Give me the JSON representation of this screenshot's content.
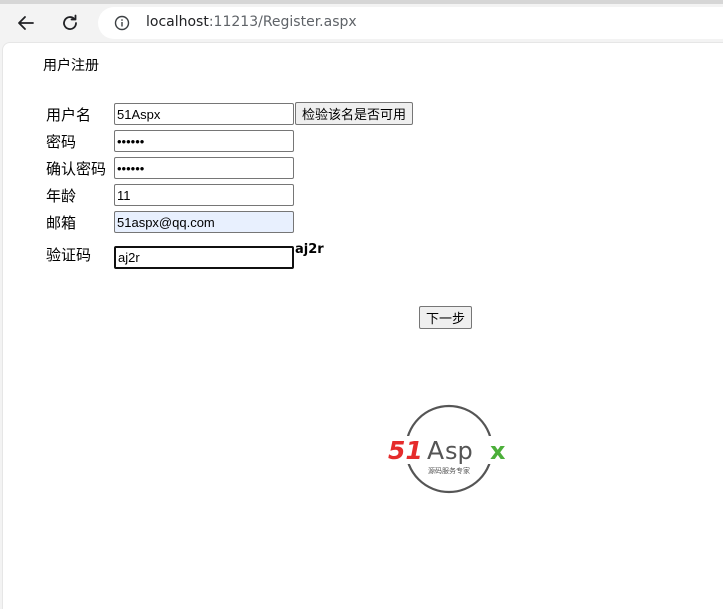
{
  "browser": {
    "url_host": "localhost",
    "url_rest": ":11213/Register.aspx"
  },
  "form": {
    "title": "用户注册",
    "username_label": "用户名",
    "username_value": "51Aspx",
    "check_button": "检验该名是否可用",
    "password_label": "密码",
    "password_value": "123456",
    "confirm_label": "确认密码",
    "confirm_value": "123456",
    "age_label": "年龄",
    "age_value": "11",
    "email_label": "邮箱",
    "email_value": "51aspx@qq.com",
    "captcha_label": "验证码",
    "captcha_value": "aj2r",
    "captcha_image_text": "aj2r",
    "next_button": "下一步"
  },
  "logo": {
    "brand_51": "51",
    "brand_a": "A",
    "brand_sp": "sp",
    "brand_x": "x",
    "tagline": "源码服务专家"
  },
  "colors": {
    "logo_red": "#e52b2b",
    "logo_green": "#4caf3a",
    "logo_gray": "#555555",
    "autofill_bg": "#e8f0fe"
  }
}
